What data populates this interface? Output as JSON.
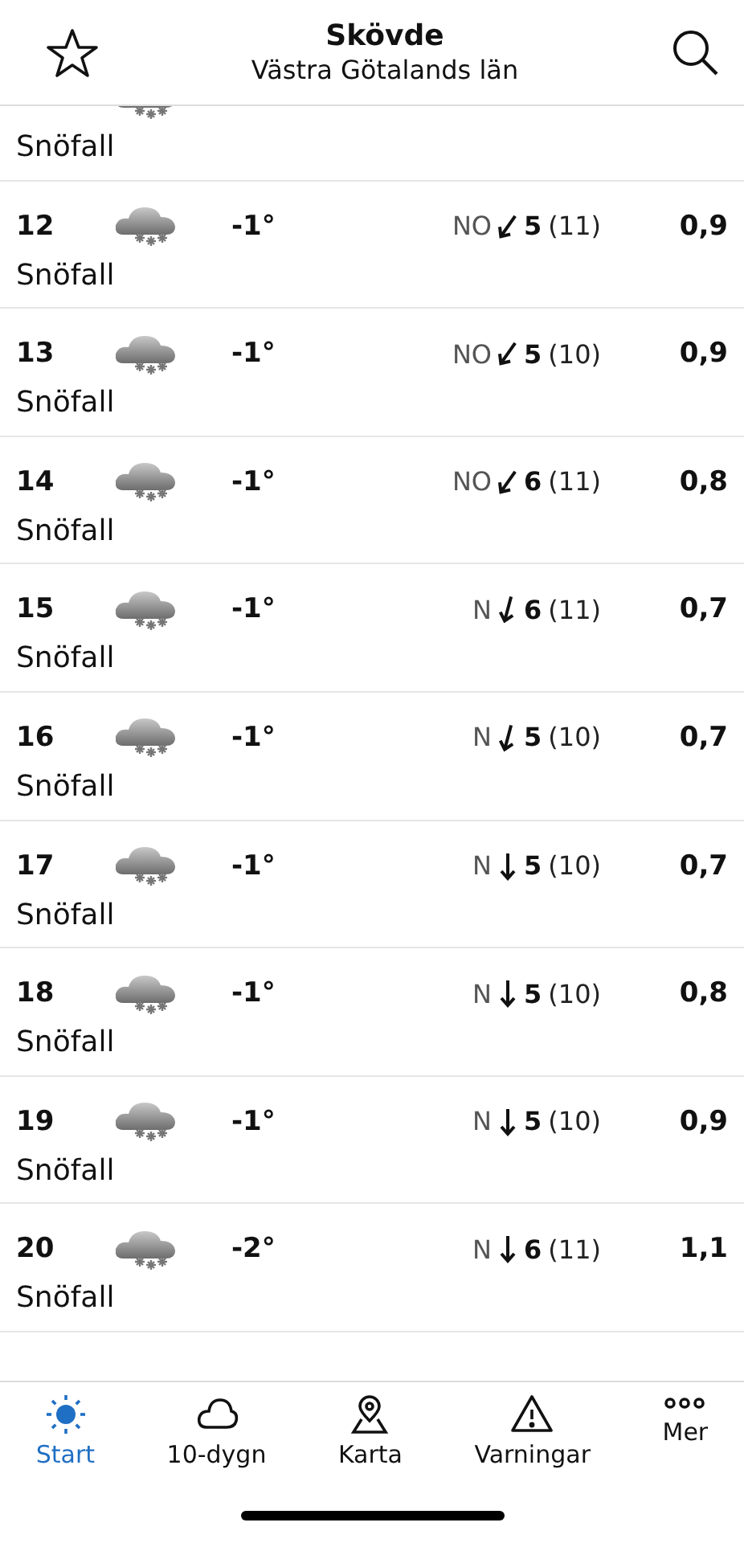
{
  "header": {
    "title": "Skövde",
    "subtitle": "Västra Götalands län"
  },
  "rows": [
    {
      "description": "Snöfall"
    },
    {
      "hour": "12",
      "temp": "-1°",
      "direction": "NO",
      "kind": "sw",
      "speed": "5",
      "gust": "(11)",
      "precip": "0,9",
      "description": "Snöfall"
    },
    {
      "hour": "13",
      "temp": "-1°",
      "direction": "NO",
      "kind": "sw",
      "speed": "5",
      "gust": "(10)",
      "precip": "0,9",
      "description": "Snöfall"
    },
    {
      "hour": "14",
      "temp": "-1°",
      "direction": "NO",
      "kind": "sw",
      "speed": "6",
      "gust": "(11)",
      "precip": "0,8",
      "description": "Snöfall"
    },
    {
      "hour": "15",
      "temp": "-1°",
      "direction": "N",
      "kind": "ssw",
      "speed": "6",
      "gust": "(11)",
      "precip": "0,7",
      "description": "Snöfall"
    },
    {
      "hour": "16",
      "temp": "-1°",
      "direction": "N",
      "kind": "ssw",
      "speed": "5",
      "gust": "(10)",
      "precip": "0,7",
      "description": "Snöfall"
    },
    {
      "hour": "17",
      "temp": "-1°",
      "direction": "N",
      "kind": "s",
      "speed": "5",
      "gust": "(10)",
      "precip": "0,7",
      "description": "Snöfall"
    },
    {
      "hour": "18",
      "temp": "-1°",
      "direction": "N",
      "kind": "s",
      "speed": "5",
      "gust": "(10)",
      "precip": "0,8",
      "description": "Snöfall"
    },
    {
      "hour": "19",
      "temp": "-1°",
      "direction": "N",
      "kind": "s",
      "speed": "5",
      "gust": "(10)",
      "precip": "0,9",
      "description": "Snöfall"
    },
    {
      "hour": "20",
      "temp": "-2°",
      "direction": "N",
      "kind": "s",
      "speed": "6",
      "gust": "(11)",
      "precip": "1,1",
      "description": "Snöfall"
    }
  ],
  "tabs": [
    {
      "label": "Start",
      "selected": true
    },
    {
      "label": "10-dygn",
      "selected": false
    },
    {
      "label": "Karta",
      "selected": false
    },
    {
      "label": "Varningar",
      "selected": false
    },
    {
      "label": "Mer",
      "selected": false
    }
  ]
}
